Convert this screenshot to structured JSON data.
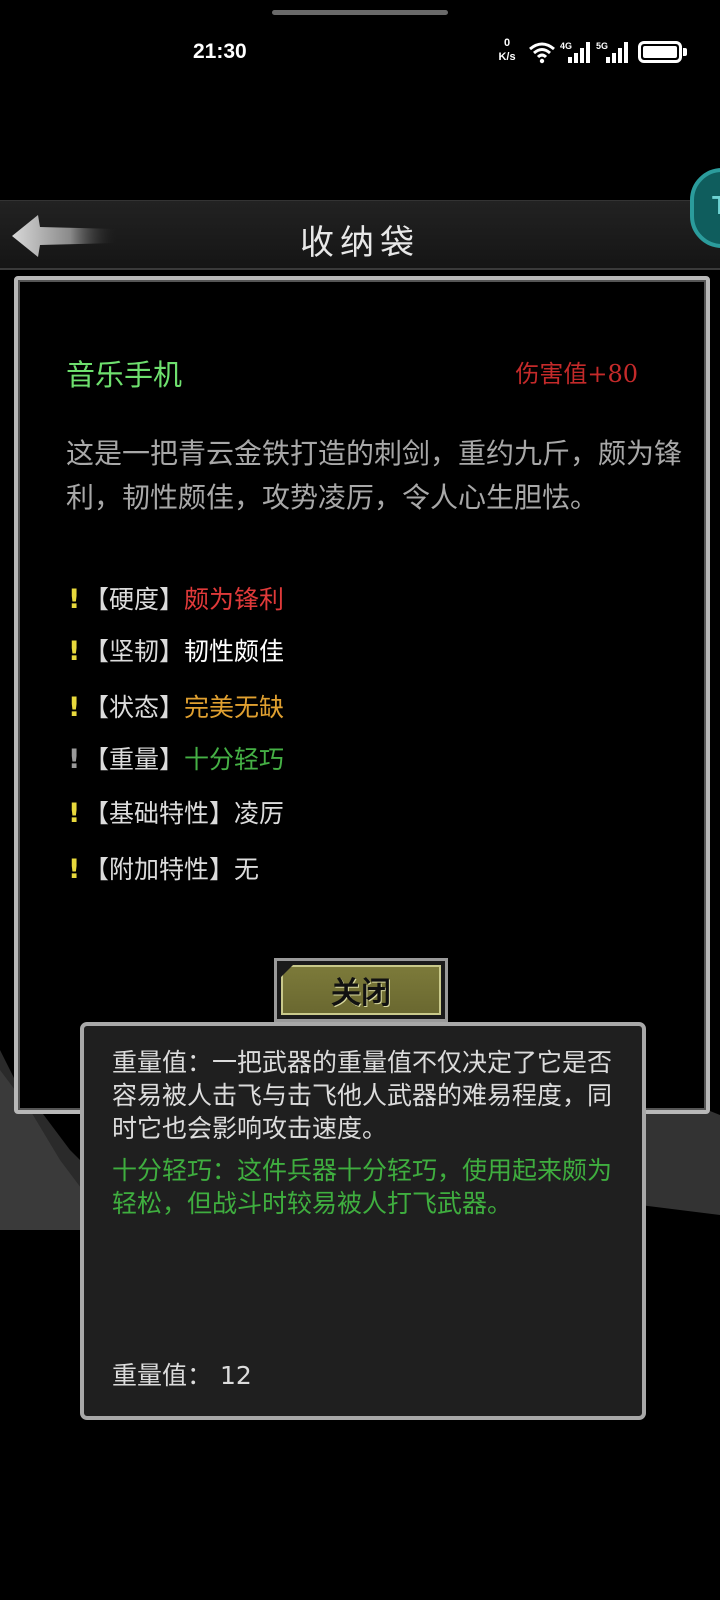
{
  "status_bar": {
    "time": "21:30",
    "net_speed_value": "0",
    "net_speed_unit": "K/s",
    "signal_1": "4G",
    "signal_2": "5G",
    "icons": [
      "wifi-icon",
      "signal-4g-icon",
      "signal-5g-icon",
      "battery-icon"
    ]
  },
  "header": {
    "title": "收纳袋",
    "back_icon": "back-arrow-icon",
    "corner_badge": "T"
  },
  "item": {
    "name": "音乐手机",
    "damage": "伤害值+80",
    "description": "这是一把青云金铁打造的刺剑，重约九斤，颇为锋利，韧性颇佳，攻势凌厉，令人心生胆怯。",
    "attributes": [
      {
        "mark": "!",
        "label": "【硬度】",
        "value": "颇为锋利",
        "color": "#e03a3a"
      },
      {
        "mark": "!",
        "label": "【坚韧】",
        "value": "韧性颇佳",
        "color": "#ffffff"
      },
      {
        "mark": "!",
        "label": "【状态】",
        "value": "完美无缺",
        "color": "#e0a030"
      },
      {
        "mark": "!",
        "label": "【重量】",
        "value": "十分轻巧",
        "color": "#45b045"
      },
      {
        "mark": "!",
        "label": "【基础特性】",
        "value": "凌厉",
        "color": "#dcdcdc"
      },
      {
        "mark": "!",
        "label": "【附加特性】",
        "value": "无",
        "color": "#dcdcdc"
      }
    ],
    "close_label": "关闭"
  },
  "tooltip": {
    "description": "重量值：一把武器的重量值不仅决定了它是否容易被人击飞与击飞他人武器的难易程度，同时它也会影响攻击速度。",
    "tier_description": "十分轻巧：这件兵器十分轻巧，使用起来颇为轻松，但战斗时较易被人打飞武器。",
    "value_line": "重量值：  12"
  }
}
